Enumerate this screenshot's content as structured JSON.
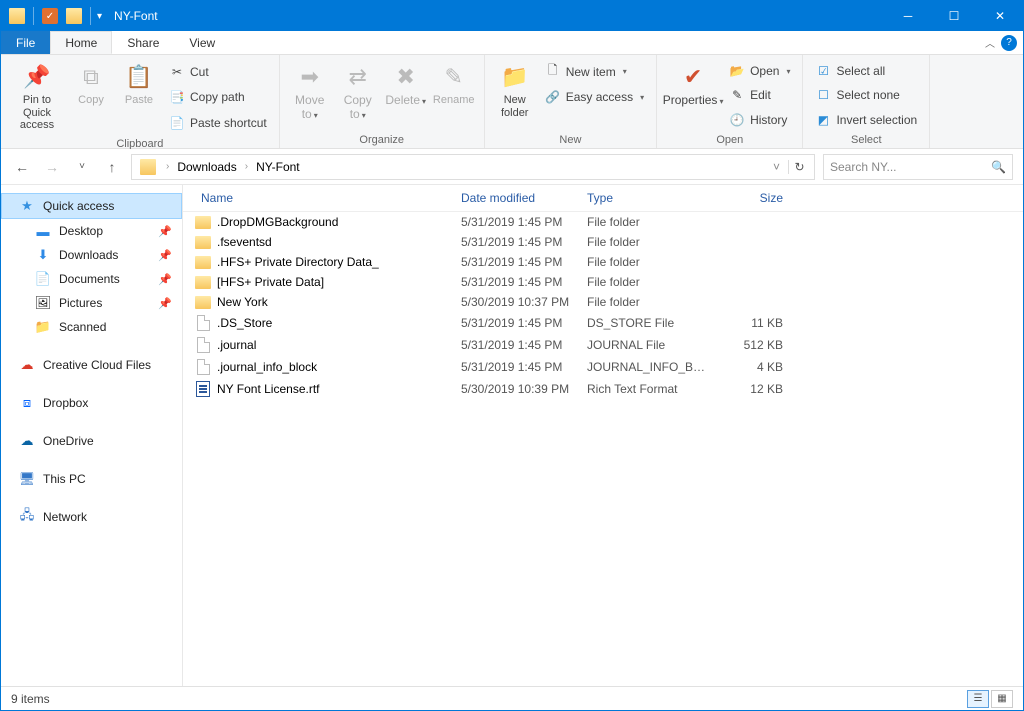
{
  "window": {
    "title": "NY-Font"
  },
  "tabs": {
    "file": "File",
    "home": "Home",
    "share": "Share",
    "view": "View"
  },
  "ribbon": {
    "clipboard": {
      "label": "Clipboard",
      "pin": "Pin to Quick access",
      "copy": "Copy",
      "paste": "Paste",
      "cut": "Cut",
      "copy_path": "Copy path",
      "paste_shortcut": "Paste shortcut"
    },
    "organize": {
      "label": "Organize",
      "move_to": "Move to",
      "copy_to": "Copy to",
      "delete": "Delete",
      "rename": "Rename"
    },
    "new_group": {
      "label": "New",
      "new_folder": "New folder",
      "new_item": "New item",
      "easy_access": "Easy access"
    },
    "open_group": {
      "label": "Open",
      "properties": "Properties",
      "open": "Open",
      "edit": "Edit",
      "history": "History"
    },
    "select_group": {
      "label": "Select",
      "select_all": "Select all",
      "select_none": "Select none",
      "invert": "Invert selection"
    }
  },
  "breadcrumb": {
    "seg1": "Downloads",
    "seg2": "NY-Font"
  },
  "search": {
    "placeholder": "Search NY..."
  },
  "columns": {
    "name": "Name",
    "date": "Date modified",
    "type": "Type",
    "size": "Size"
  },
  "sidebar": {
    "quick_access": "Quick access",
    "desktop": "Desktop",
    "downloads": "Downloads",
    "documents": "Documents",
    "pictures": "Pictures",
    "scanned": "Scanned",
    "ccf": "Creative Cloud Files",
    "dropbox": "Dropbox",
    "onedrive": "OneDrive",
    "thispc": "This PC",
    "network": "Network"
  },
  "files": [
    {
      "name": ".DropDMGBackground",
      "date": "5/31/2019 1:45 PM",
      "type": "File folder",
      "size": "",
      "kind": "folder"
    },
    {
      "name": ".fseventsd",
      "date": "5/31/2019 1:45 PM",
      "type": "File folder",
      "size": "",
      "kind": "folder"
    },
    {
      "name": ".HFS+ Private Directory Data_",
      "date": "5/31/2019 1:45 PM",
      "type": "File folder",
      "size": "",
      "kind": "folder"
    },
    {
      "name": "[HFS+ Private Data]",
      "date": "5/31/2019 1:45 PM",
      "type": "File folder",
      "size": "",
      "kind": "folder"
    },
    {
      "name": "New York",
      "date": "5/30/2019 10:37 PM",
      "type": "File folder",
      "size": "",
      "kind": "folder"
    },
    {
      "name": ".DS_Store",
      "date": "5/31/2019 1:45 PM",
      "type": "DS_STORE File",
      "size": "11 KB",
      "kind": "file"
    },
    {
      "name": ".journal",
      "date": "5/31/2019 1:45 PM",
      "type": "JOURNAL File",
      "size": "512 KB",
      "kind": "file"
    },
    {
      "name": ".journal_info_block",
      "date": "5/31/2019 1:45 PM",
      "type": "JOURNAL_INFO_BL...",
      "size": "4 KB",
      "kind": "file"
    },
    {
      "name": "NY Font License.rtf",
      "date": "5/30/2019 10:39 PM",
      "type": "Rich Text Format",
      "size": "12 KB",
      "kind": "rtf"
    }
  ],
  "status": {
    "count": "9 items"
  }
}
